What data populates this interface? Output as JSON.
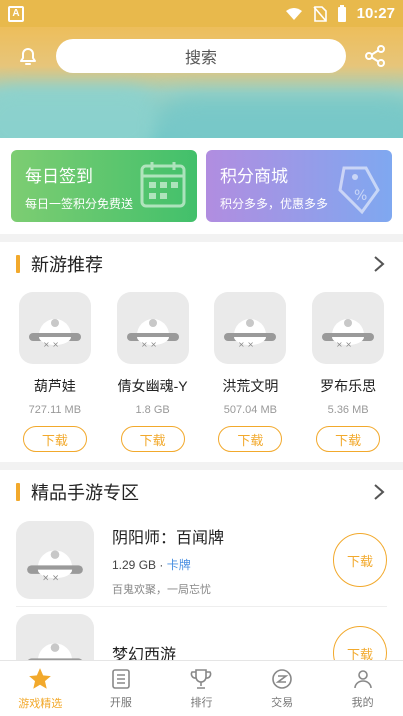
{
  "status_bar": {
    "time": "10:27"
  },
  "header": {
    "search_placeholder": "搜索"
  },
  "cards": [
    {
      "title": "每日签到",
      "subtitle": "每日一签积分免费送",
      "icon": "calendar-icon"
    },
    {
      "title": "积分商城",
      "subtitle": "积分多多，优惠多多",
      "icon": "discount-tag-icon"
    }
  ],
  "new_games": {
    "title": "新游推荐",
    "games": [
      {
        "name": "葫芦娃",
        "size": "727.11 MB",
        "button": "下载"
      },
      {
        "name": "倩女幽魂-Y",
        "size": "1.8 GB",
        "button": "下载"
      },
      {
        "name": "洪荒文明",
        "size": "507.04 MB",
        "button": "下载"
      },
      {
        "name": "罗布乐思",
        "size": "5.36 MB",
        "button": "下载"
      }
    ]
  },
  "premium": {
    "title": "精品手游专区",
    "items": [
      {
        "name": "阴阳师：百闻牌",
        "size": "1.29 GB",
        "sep": " · ",
        "tag": "卡牌",
        "desc": "百鬼欢聚，一局忘忧",
        "button": "下载"
      },
      {
        "name": "梦幻西游",
        "button": "下载"
      }
    ]
  },
  "tabs": [
    {
      "label": "游戏精选",
      "icon": "star-icon",
      "active": true
    },
    {
      "label": "开服",
      "icon": "document-icon",
      "active": false
    },
    {
      "label": "排行",
      "icon": "trophy-icon",
      "active": false
    },
    {
      "label": "交易",
      "icon": "exchange-icon",
      "active": false
    },
    {
      "label": "我的",
      "icon": "user-icon",
      "active": false
    }
  ],
  "colors": {
    "accent": "#f2a92c",
    "tag_blue": "#4a90e2"
  }
}
